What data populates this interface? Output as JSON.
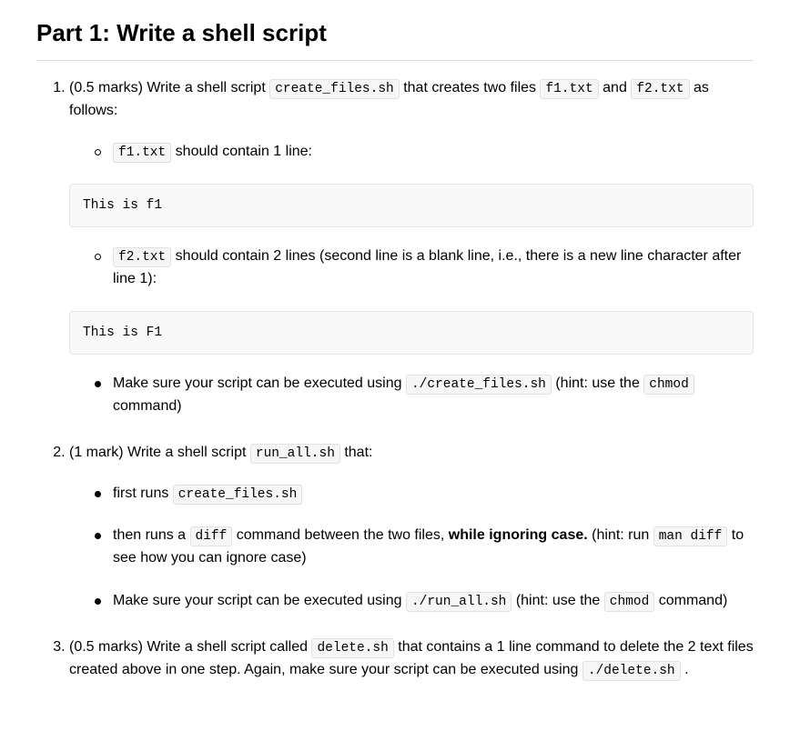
{
  "title": "Part 1: Write a shell script",
  "items": [
    {
      "marks": "(0.5 marks)",
      "lead1": "Write a shell script ",
      "code1": "create_files.sh",
      "lead2": " that creates two files ",
      "code2": "f1.txt",
      "lead3": " and ",
      "code3": "f2.txt",
      "lead4": " as follows:",
      "sub": [
        {
          "pre_code": "f1.txt",
          "post": " should contain 1 line:",
          "block": "This is f1"
        },
        {
          "pre_code": "f2.txt",
          "post": " should contain 2 lines (second line is a blank line, i.e., there is a new line character after line 1):",
          "block": "This is F1"
        },
        {
          "t1": "Make sure your script can be executed using ",
          "c1": "./create_files.sh",
          "t2": " (hint: use the ",
          "c2": "chmod",
          "t3": " command)"
        }
      ]
    },
    {
      "marks": "(1 mark)",
      "lead1": "Write a shell script ",
      "code1": "run_all.sh",
      "lead2": " that:",
      "sub": [
        {
          "t1": "first runs ",
          "c1": "create_files.sh"
        },
        {
          "t1": "then runs a ",
          "c1": "diff",
          "t2": " command between the two files, ",
          "bold": "while ignoring case.",
          "t3": " (hint: run ",
          "c2": "man diff",
          "t4": " to see how you can ignore case)"
        },
        {
          "t1": "Make sure your script can be executed using ",
          "c1": "./run_all.sh",
          "t2": " (hint: use the ",
          "c2": "chmod",
          "t3": " command)"
        }
      ]
    },
    {
      "marks": "(0.5 marks)",
      "lead1": "Write a shell script called ",
      "code1": "delete.sh",
      "lead2": " that contains a 1 line command to delete the 2 text files created above in one step. Again, make sure your script can be executed using ",
      "code2": "./delete.sh",
      "lead3": " ."
    }
  ]
}
